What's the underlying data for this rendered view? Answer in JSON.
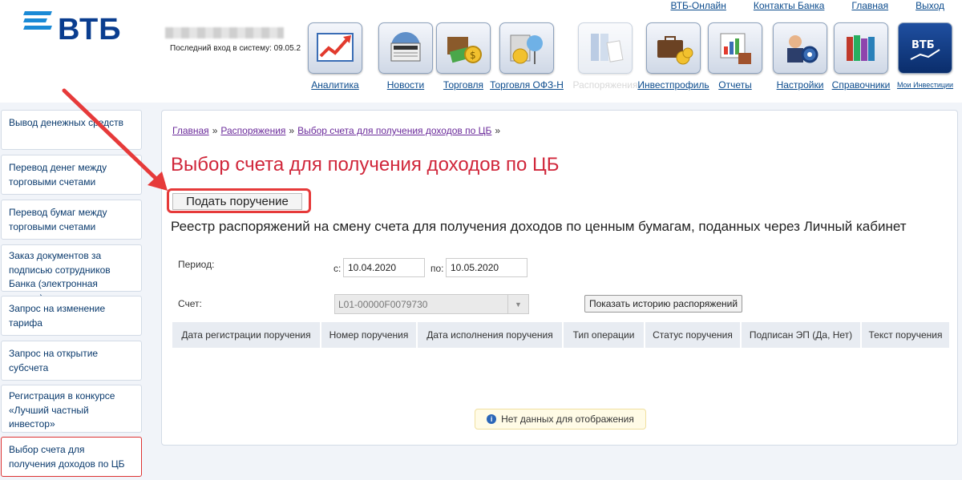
{
  "header": {
    "top_links": [
      "ВТБ-Онлайн",
      "Контакты Банка",
      "Главная",
      "Выход"
    ],
    "logo_text": "ВТБ",
    "last_login": "Последний вход в систему: 09.05.2",
    "apps": [
      {
        "label": "Аналитика",
        "icon": "analytics-icon"
      },
      {
        "label": "Новости",
        "icon": "news-icon"
      },
      {
        "label": "Торговля",
        "icon": "trading-icon"
      },
      {
        "label": "Торговля ОФЗ-Н",
        "icon": "ofz-trading-icon"
      },
      {
        "label": "Распоряжения",
        "icon": "orders-icon",
        "disabled": true
      },
      {
        "label": "Инвестпрофиль",
        "icon": "invest-profile-icon"
      },
      {
        "label": "Отчеты",
        "icon": "reports-icon"
      },
      {
        "label": "Настройки",
        "icon": "settings-icon"
      },
      {
        "label": "Справочники",
        "icon": "reference-books-icon"
      },
      {
        "label": "Мои Инвестиции",
        "icon": "my-investments-icon"
      }
    ]
  },
  "sidebar": {
    "items": [
      {
        "label": "Вывод денежных средств"
      },
      {
        "label": "Перевод денег между торговыми счетами"
      },
      {
        "label": "Перевод бумаг между торговыми счетами"
      },
      {
        "label": "Заказ документов за подписью сотрудников Банка (электронная версия)"
      },
      {
        "label": "Запрос на изменение тарифа"
      },
      {
        "label": "Запрос на открытие субсчета"
      },
      {
        "label": "Регистрация в конкурсе «Лучший частный инвестор»"
      },
      {
        "label": "Выбор счета для получения доходов по ЦБ",
        "active": true
      }
    ]
  },
  "breadcrumb": {
    "home": "Главная",
    "sep": "»",
    "orders": "Распоряжения",
    "current": "Выбор счета для получения доходов по ЦБ"
  },
  "main": {
    "title": "Выбор счета для получения доходов по ЦБ",
    "submit_label": "Подать поручение",
    "registry_title": "Реестр распоряжений на смену счета для получения доходов по ценным бумагам, поданных через Личный кабинет",
    "period_label": "Период:",
    "from_label": "с:",
    "from_value": "10.04.2020",
    "to_label": "по:",
    "to_value": "10.05.2020",
    "account_label": "Счет:",
    "account_value": "L01-00000F0079730",
    "history_button": "Показать историю распоряжений",
    "table_headers": [
      "Дата регистрации поручения",
      "Номер поручения",
      "Дата исполнения поручения",
      "Тип операции",
      "Статус поручения",
      "Подписан ЭП (Да, Нет)",
      "Текст поручения"
    ],
    "no_data": "Нет данных для отображения"
  },
  "colors": {
    "accent_red": "#d0263a",
    "link_blue": "#0a4a8c",
    "annotation_red": "#e63a3a"
  }
}
